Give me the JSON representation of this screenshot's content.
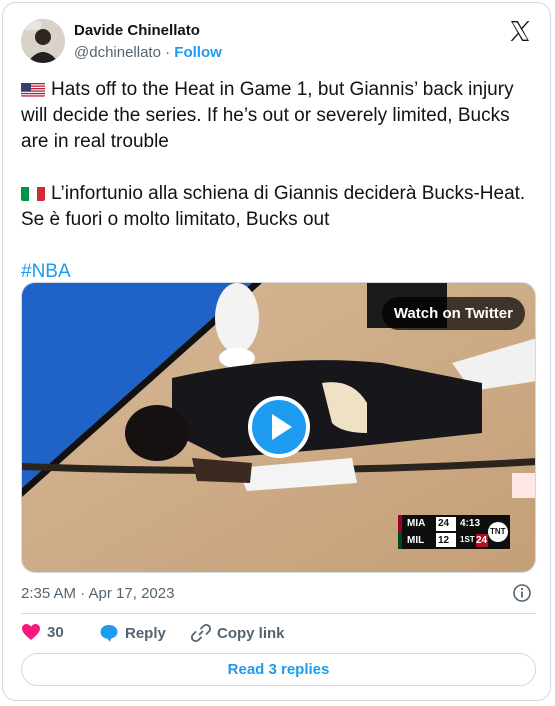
{
  "author": {
    "name": "Davide Chinellato",
    "handle": "@dchinellato",
    "separator": "·",
    "follow_label": "Follow"
  },
  "tweet": {
    "paragraph_en": "Hats off to the Heat in Game 1, but Giannis’ back injury will decide the series. If he’s out or severely limited, Bucks are in real trouble",
    "paragraph_it": "L’infortunio alla schiena di Giannis deciderà Bucks-Heat. Se è fuori o molto limitato, Bucks out",
    "hashtag": "#NBA"
  },
  "media": {
    "watch_label": "Watch on Twitter",
    "scoreboard": {
      "team1": "MIA",
      "score1": "24",
      "team2": "MIL",
      "score2": "12",
      "clock": "4:13",
      "quarter": "1ST",
      "shot_clock": "24",
      "network": "TNT"
    }
  },
  "timestamp": "2:35 AM · Apr 17, 2023",
  "actions": {
    "likes": "30",
    "reply_label": "Reply",
    "copy_label": "Copy link"
  },
  "read_replies_label": "Read 3 replies",
  "colors": {
    "accent": "#1d9bf0",
    "heart": "#f91880",
    "muted": "#536471"
  }
}
